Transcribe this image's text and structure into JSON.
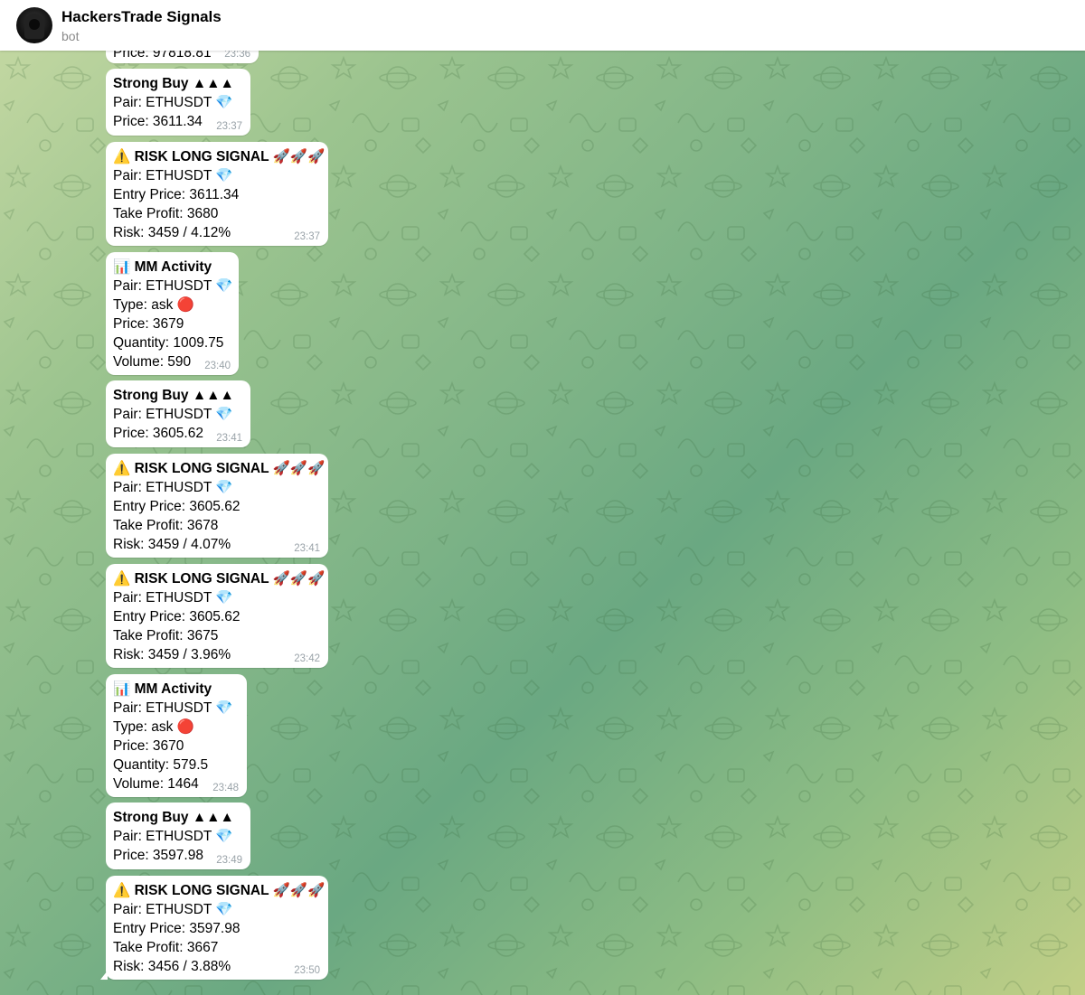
{
  "header": {
    "title": "HackersTrade Signals",
    "subtitle": "bot"
  },
  "messages": [
    {
      "lines": [
        "Price: 97818.81"
      ],
      "time": "23:36",
      "partial": true
    },
    {
      "lines": [
        "Strong Buy ▲▲▲",
        "Pair: ETHUSDT 💎",
        "Price: 3611.34"
      ],
      "time": "23:37"
    },
    {
      "lines": [
        "⚠️ RISK LONG SIGNAL 🚀🚀🚀",
        "Pair: ETHUSDT 💎",
        "Entry Price: 3611.34",
        "Take Profit: 3680",
        "Risk: 3459 / 4.12%"
      ],
      "time": "23:37"
    },
    {
      "lines": [
        "📊 MM Activity",
        "Pair: ETHUSDT 💎",
        "Type: ask 🔴",
        "Price: 3679",
        "Quantity: 1009.75",
        "Volume: 590"
      ],
      "time": "23:40"
    },
    {
      "lines": [
        "Strong Buy ▲▲▲",
        "Pair: ETHUSDT 💎",
        "Price: 3605.62"
      ],
      "time": "23:41"
    },
    {
      "lines": [
        "⚠️ RISK LONG SIGNAL 🚀🚀🚀",
        "Pair: ETHUSDT 💎",
        "Entry Price: 3605.62",
        "Take Profit: 3678",
        "Risk: 3459 / 4.07%"
      ],
      "time": "23:41"
    },
    {
      "lines": [
        "⚠️ RISK LONG SIGNAL 🚀🚀🚀",
        "Pair: ETHUSDT 💎",
        "Entry Price: 3605.62",
        "Take Profit: 3675",
        "Risk: 3459 / 3.96%"
      ],
      "time": "23:42"
    },
    {
      "lines": [
        "📊 MM Activity",
        "Pair: ETHUSDT 💎",
        "Type: ask 🔴",
        "Price: 3670",
        "Quantity: 579.5",
        "Volume: 1464"
      ],
      "time": "23:48"
    },
    {
      "lines": [
        "Strong Buy ▲▲▲",
        "Pair: ETHUSDT 💎",
        "Price: 3597.98"
      ],
      "time": "23:49"
    },
    {
      "lines": [
        "⚠️ RISK LONG SIGNAL 🚀🚀🚀",
        "Pair: ETHUSDT 💎",
        "Entry Price: 3597.98",
        "Take Profit: 3667",
        "Risk: 3456 / 3.88%"
      ],
      "time": "23:50"
    }
  ]
}
